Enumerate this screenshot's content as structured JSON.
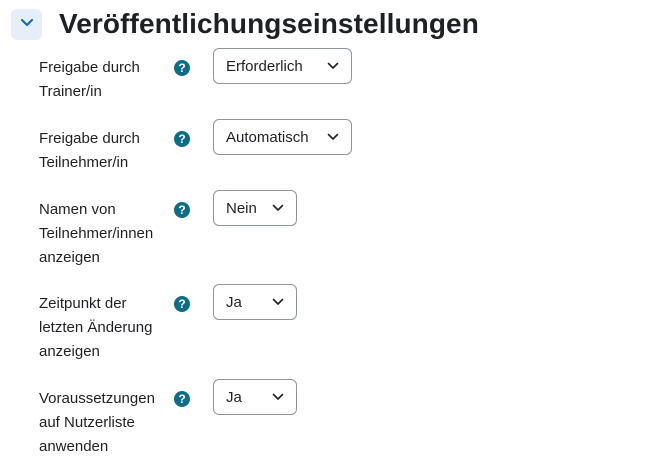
{
  "section": {
    "title": "Veröffentlichungseinstellungen",
    "toggle_icon": "chevron-down-icon",
    "accent": "#0f6c87"
  },
  "settings": [
    {
      "label": "Freigabe durch Trainer/in",
      "value": "Erforderlich"
    },
    {
      "label": "Freigabe durch Teilnehmer/in",
      "value": "Automatisch"
    },
    {
      "label": "Namen von Teilnehmer/innen anzeigen",
      "value": "Nein"
    },
    {
      "label": "Zeitpunkt der letzten Änderung anzeigen",
      "value": "Ja"
    },
    {
      "label": "Voraussetzungen auf Nutzerliste anwenden",
      "value": "Ja"
    }
  ],
  "help_icon": {
    "name": "help-icon",
    "glyph": "?"
  }
}
